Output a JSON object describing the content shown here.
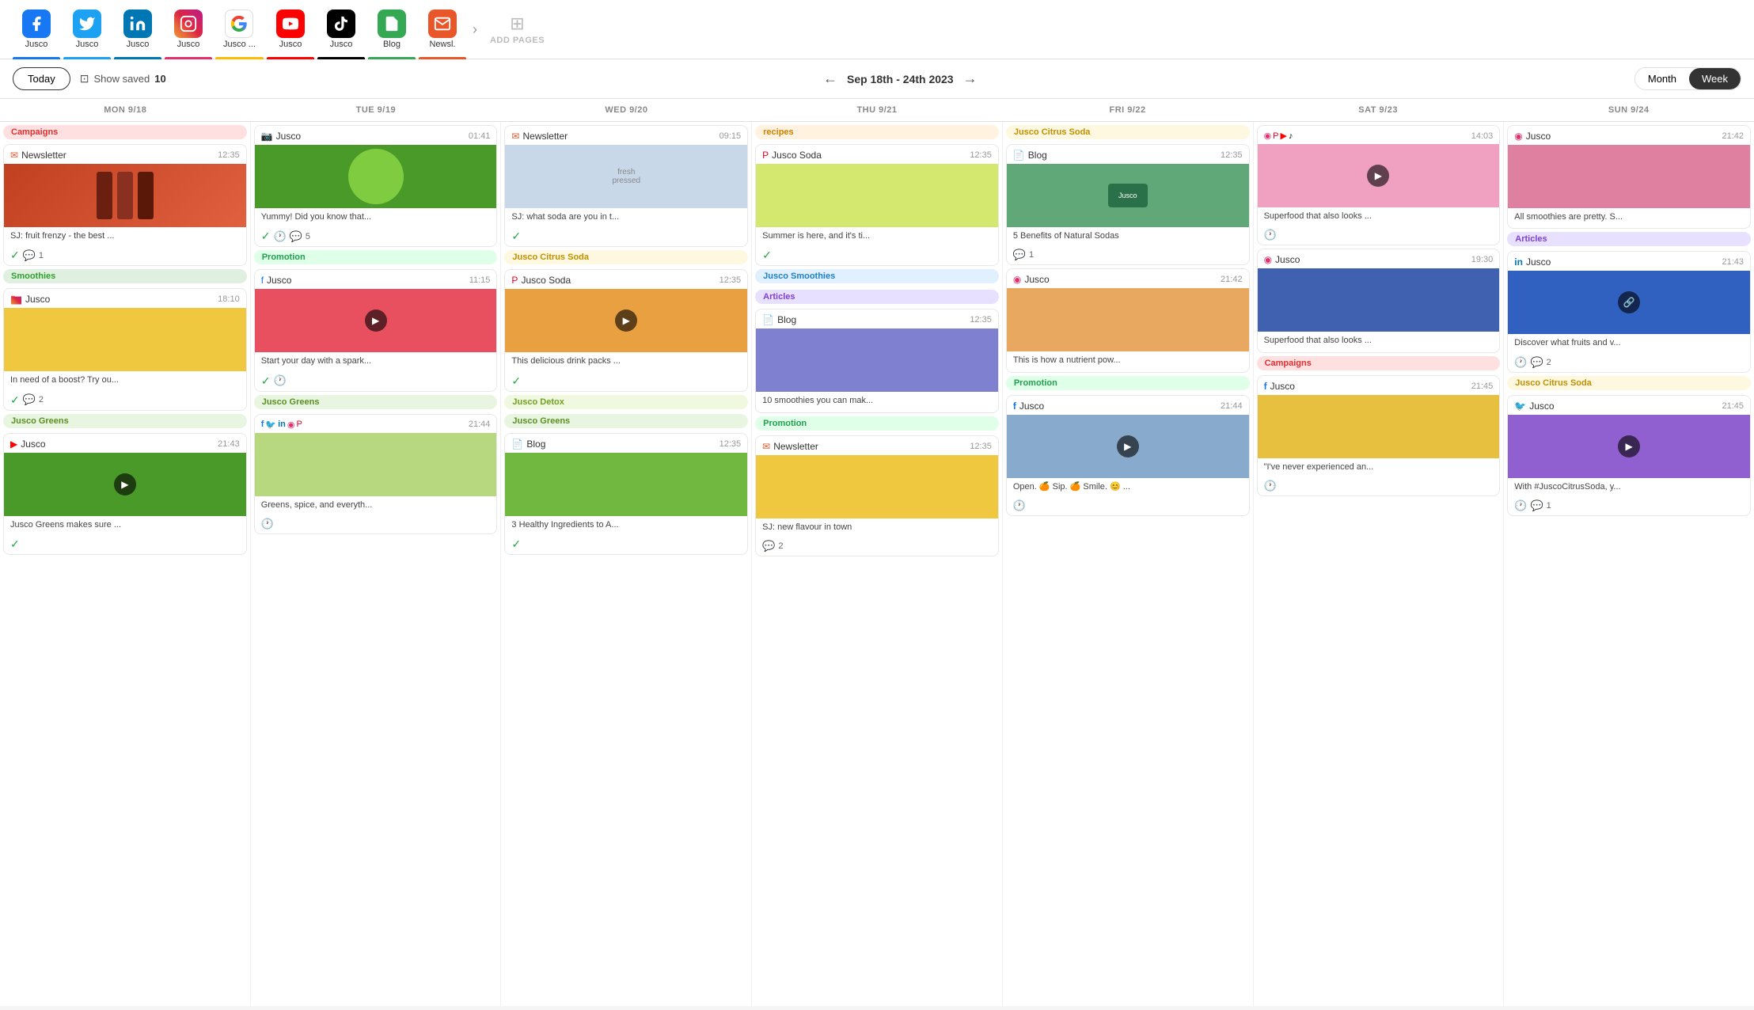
{
  "topNav": {
    "items": [
      {
        "label": "Jusco",
        "icon": "f",
        "platform": "facebook",
        "color": "#1877f2",
        "barColor": "#1877f2"
      },
      {
        "label": "Jusco",
        "icon": "t",
        "platform": "twitter",
        "color": "#1da1f2",
        "barColor": "#1da1f2"
      },
      {
        "label": "Jusco",
        "icon": "in",
        "platform": "linkedin",
        "color": "#0077b5",
        "barColor": "#0077b5"
      },
      {
        "label": "Jusco",
        "icon": "ig",
        "platform": "instagram",
        "color": "#e1306c",
        "barColor": "#e1306c"
      },
      {
        "label": "Jusco ...",
        "icon": "G",
        "platform": "google",
        "color": "#4285f4",
        "barColor": "#fbbc04"
      },
      {
        "label": "Jusco",
        "icon": "yt",
        "platform": "youtube",
        "color": "#ff0000",
        "barColor": "#ff0000"
      },
      {
        "label": "Jusco",
        "icon": "tt",
        "platform": "tiktok",
        "color": "#010101",
        "barColor": "#010101"
      },
      {
        "label": "Blog",
        "icon": "bl",
        "platform": "blog",
        "color": "#34a853",
        "barColor": "#34a853"
      },
      {
        "label": "Newsl.",
        "icon": "nl",
        "platform": "newsletter",
        "color": "#e8562a",
        "barColor": "#e8562a"
      }
    ],
    "addPages": "ADD PAGES"
  },
  "toolbar": {
    "todayLabel": "Today",
    "showSavedLabel": "Show saved",
    "showSavedCount": "10",
    "dateRange": "Sep 18th - 24th 2023",
    "monthLabel": "Month",
    "weekLabel": "Week"
  },
  "dayHeaders": [
    {
      "label": "MON 9/18"
    },
    {
      "label": "TUE 9/19"
    },
    {
      "label": "WED 9/20"
    },
    {
      "label": "THU 9/21"
    },
    {
      "label": "FRI 9/22"
    },
    {
      "label": "SAT 9/23"
    },
    {
      "label": "SUN 9/24"
    }
  ],
  "columns": {
    "mon": {
      "groups": [
        {
          "label": "Campaigns",
          "labelClass": "campaigns",
          "cards": [
            {
              "platform": "Newsletter",
              "platformIcon": "nl",
              "time": "12:35",
              "imgClass": "img-newsletter",
              "text": "SJ: fruit frenzy - the best ...",
              "status": [
                "check",
                "comment"
              ],
              "commentCount": "1"
            }
          ]
        },
        {
          "label": "Smoothies",
          "labelClass": "smoothies",
          "cards": [
            {
              "platform": "Jusco",
              "platformIcon": "ig",
              "time": "18:10",
              "imgClass": "img-yellow",
              "text": "In need of a boost? Try ou...",
              "status": [
                "check",
                "comment"
              ],
              "commentCount": "2"
            }
          ]
        },
        {
          "label": "Jusco Greens",
          "labelClass": "jusco-greens",
          "cards": [
            {
              "platform": "Jusco",
              "platformIcon": "yt",
              "time": "21:43",
              "imgClass": "img-greens",
              "hasPlay": true,
              "text": "Jusco Greens makes sure ...",
              "status": [
                "check"
              ]
            }
          ]
        }
      ]
    },
    "tue": {
      "groups": [
        {
          "label": "",
          "labelClass": "",
          "cards": [
            {
              "platform": "Jusco",
              "platformIcon": "ig",
              "time": "01:41",
              "imgClass": "img-kiwi",
              "text": "Yummy! Did you know that...",
              "status": [
                "check",
                "clock",
                "comment"
              ],
              "commentCount": "5"
            }
          ]
        },
        {
          "label": "Promotion",
          "labelClass": "promotion",
          "cards": [
            {
              "platform": "Jusco",
              "platformIcon": "fb",
              "time": "11:15",
              "imgClass": "img-watermelon",
              "hasPlay": true,
              "text": "Start your day with a spark...",
              "status": [
                "check",
                "clock"
              ]
            }
          ]
        },
        {
          "label": "Jusco Greens",
          "labelClass": "jusco-greens",
          "multiIcons": [
            "fb",
            "tw",
            "li",
            "ig",
            "pi"
          ],
          "cards": [
            {
              "platform": "",
              "platformIcon": "",
              "time": "21:44",
              "imgClass": "img-greens2",
              "text": "Greens, spice, and everyth...",
              "status": [
                "clock"
              ]
            }
          ]
        }
      ]
    },
    "wed": {
      "groups": [
        {
          "label": "",
          "labelClass": "",
          "cards": [
            {
              "platform": "Newsletter",
              "platformIcon": "nl",
              "time": "09:15",
              "imgClass": "img-drink",
              "text": "SJ: what soda are you in t...",
              "status": [
                "check"
              ]
            }
          ]
        },
        {
          "label": "Jusco Citrus Soda",
          "labelClass": "jusco-citrus",
          "cards": [
            {
              "platform": "Jusco Soda",
              "platformIcon": "pi",
              "time": "12:35",
              "imgClass": "img-citrus",
              "hasPlay": true,
              "text": "This delicious drink packs ...",
              "status": [
                "check"
              ]
            }
          ]
        },
        {
          "label": "Jusco Detox",
          "labelClass": "jusco-detox",
          "cards": []
        },
        {
          "label": "Jusco Greens",
          "labelClass": "jusco-greens2",
          "cards": [
            {
              "platform": "Blog",
              "platformIcon": "bl",
              "time": "12:35",
              "imgClass": "img-hand-greens",
              "text": "3 Healthy Ingredients to A...",
              "status": [
                "check"
              ]
            }
          ]
        }
      ]
    },
    "thu": {
      "groups": [
        {
          "label": "recipes",
          "labelClass": "recipes",
          "cards": [
            {
              "platform": "Jusco Soda",
              "platformIcon": "pi",
              "time": "12:35",
              "imgClass": "img-soda",
              "text": "Summer is here, and it's ti...",
              "status": [
                "check"
              ]
            }
          ]
        },
        {
          "label": "Jusco Smoothies",
          "labelClass": "jusco-smoothies",
          "cards": [
            {
              "platform": "Blog",
              "platformIcon": "bl",
              "time": "12:35",
              "imgClass": "img-smoothie",
              "text": "10 smoothies you can mak...",
              "status": []
            }
          ]
        },
        {
          "label": "Articles",
          "labelClass": "articles",
          "cards": []
        },
        {
          "label": "Promotion",
          "labelClass": "promotion",
          "cards": [
            {
              "platform": "Newsletter",
              "platformIcon": "nl",
              "time": "12:35",
              "imgClass": "img-yellow2",
              "text": "SJ: new flavour in town",
              "status": [
                "comment"
              ],
              "commentCount": "2"
            }
          ]
        }
      ]
    },
    "fri": {
      "groups": [
        {
          "label": "Jusco Citrus Soda",
          "labelClass": "jusco-citrus",
          "cards": [
            {
              "platform": "Blog",
              "platformIcon": "bl",
              "time": "12:35",
              "imgClass": "img-jusco-card",
              "text": "5 Benefits of Natural Sodas",
              "status": [
                "comment"
              ],
              "commentCount": "1"
            }
          ]
        },
        {
          "label": "",
          "labelClass": "",
          "cards": [
            {
              "platform": "Jusco",
              "platformIcon": "ig",
              "time": "21:42",
              "imgClass": "img-apricot",
              "text": "This is how a nutrient pow...",
              "status": []
            }
          ]
        },
        {
          "label": "Promotion",
          "labelClass": "promotion",
          "cards": [
            {
              "platform": "Jusco",
              "platformIcon": "fb",
              "time": "21:44",
              "imgClass": "img-drink",
              "hasPlay": true,
              "text": "Open. 🍊 Sip. 🍊 Smile. 😊 ...",
              "status": [
                "clock"
              ]
            }
          ]
        }
      ]
    },
    "sat": {
      "groups": [
        {
          "label": "",
          "labelClass": "",
          "multiIcons": [
            "ig",
            "pi",
            "yt",
            "tt"
          ],
          "cards": [
            {
              "platform": "",
              "platformIcon": "",
              "time": "14:03",
              "imgClass": "img-pink",
              "hasPlay": true,
              "text": "Superfood that also looks ...",
              "status": [
                "clock"
              ]
            }
          ]
        },
        {
          "label": "",
          "labelClass": "",
          "cards": [
            {
              "platform": "Jusco",
              "platformIcon": "ig",
              "time": "19:30",
              "imgClass": "img-blueberry",
              "text": "Superfood that also looks ...",
              "status": []
            }
          ]
        },
        {
          "label": "Campaigns",
          "labelClass": "campaigns",
          "cards": [
            {
              "platform": "Jusco",
              "platformIcon": "fb",
              "time": "21:45",
              "imgClass": "img-citrus",
              "text": "\"I've never experienced an...",
              "status": [
                "clock"
              ]
            }
          ]
        }
      ]
    },
    "sun": {
      "groups": [
        {
          "label": "",
          "labelClass": "",
          "cards": [
            {
              "platform": "Jusco",
              "platformIcon": "ig",
              "time": "21:42",
              "imgClass": "img-cocktail",
              "text": "All smoothies are pretty. S...",
              "status": []
            }
          ]
        },
        {
          "label": "Articles",
          "labelClass": "articles",
          "cards": [
            {
              "platform": "Jusco",
              "platformIcon": "li",
              "time": "21:43",
              "imgClass": "img-blue-bg",
              "hasLink": true,
              "text": "Discover what fruits and v...",
              "status": [
                "clock",
                "comment"
              ],
              "commentCount": "2"
            }
          ]
        },
        {
          "label": "Jusco Citrus Soda",
          "labelClass": "jusco-citrus2",
          "cards": [
            {
              "platform": "Jusco",
              "platformIcon": "tw",
              "time": "21:45",
              "imgClass": "img-purple",
              "hasPlay": true,
              "text": "With #JuscoCitrusSoda, y...",
              "status": [
                "clock",
                "comment"
              ],
              "commentCount": "1"
            }
          ]
        }
      ]
    }
  },
  "platformIcons": {
    "fb": "🟦",
    "tw": "🐦",
    "ig": "📷",
    "nl": "✉️",
    "pi": "📌",
    "bl": "📄",
    "li": "🔷",
    "yt": "▶️",
    "tt": "🎵",
    "gm": "G"
  }
}
